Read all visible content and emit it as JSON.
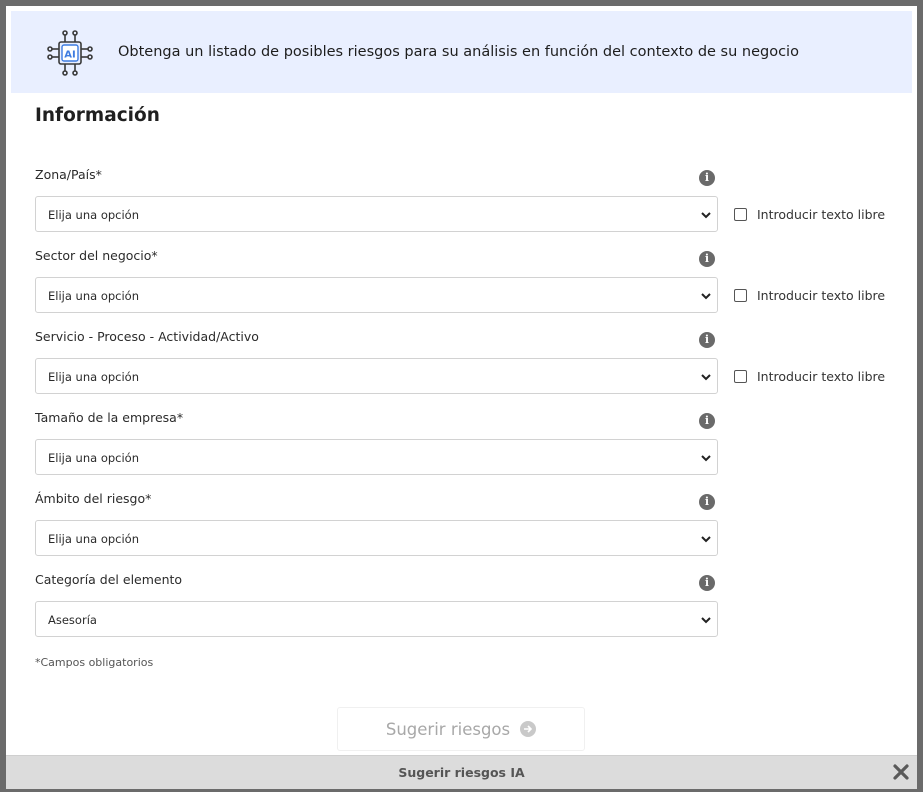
{
  "banner": {
    "icon": "ai-chip-icon",
    "icon_text": "AI",
    "text": "Obtenga un listado de posibles riesgos para su análisis en función del contexto de su negocio"
  },
  "section_title": "Información",
  "fields": [
    {
      "label": "Zona/País*",
      "value": "Elija una opción",
      "free_text_label": "Introducir texto libre",
      "free_text_checked": false
    },
    {
      "label": "Sector del negocio*",
      "value": "Elija una opción",
      "free_text_label": "Introducir texto libre",
      "free_text_checked": false
    },
    {
      "label": "Servicio - Proceso - Actividad/Activo",
      "value": "Elija una opción",
      "free_text_label": "Introducir texto libre",
      "free_text_checked": false
    },
    {
      "label": "Tamaño de la empresa*",
      "value": "Elija una opción"
    },
    {
      "label": "Ámbito del riesgo*",
      "value": "Elija una opción"
    },
    {
      "label": "Categoría del elemento",
      "value": "Asesoría"
    }
  ],
  "info_icon_glyph": "i",
  "required_note": "*Campos obligatorios",
  "suggest_button": {
    "label": "Sugerir riesgos",
    "icon": "arrow-right-circle-icon"
  },
  "footer": {
    "title": "Sugerir riesgos IA",
    "close_icon": "close-icon"
  }
}
